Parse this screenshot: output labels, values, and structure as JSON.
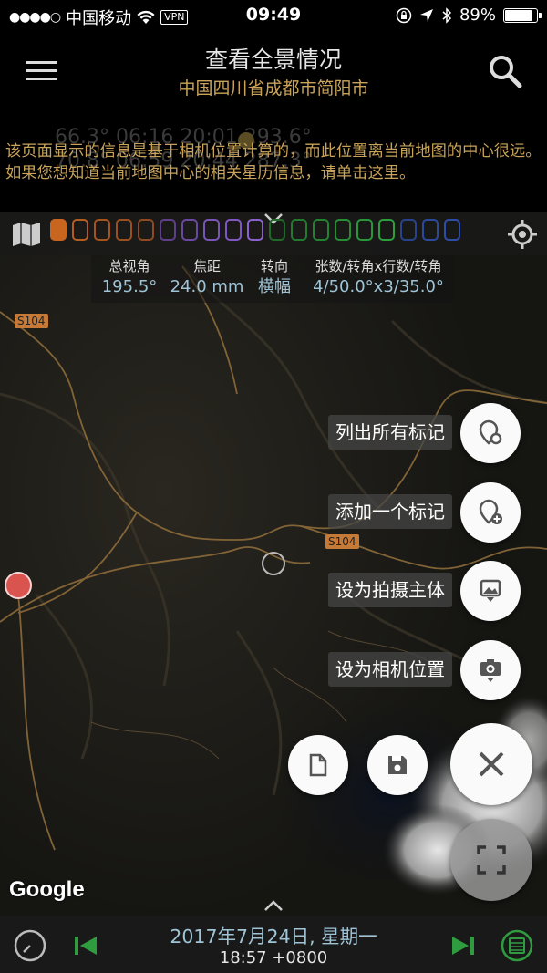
{
  "status_bar": {
    "carrier": "中国移动",
    "vpn": "VPN",
    "time": "09:49",
    "battery": "89%",
    "battery_level": 0.89
  },
  "header": {
    "title": "查看全景情况",
    "subtitle": "中国四川省成都市简阳市"
  },
  "notice": "该页面显示的信息是基于相机位置计算的，而此位置离当前地图的中心很远。如果您想知道当前地图中心的相关星历信息，请单击这里。",
  "ghost_row1": "66.3°  06:16        20:01  293.6°",
  "ghost_row2": "70.8°  06:59        20:44  287.3°",
  "stats": [
    {
      "label": "总视角",
      "value": "195.5°"
    },
    {
      "label": "焦距",
      "value": "24.0 mm"
    },
    {
      "label": "转向",
      "value": "横幅"
    },
    {
      "label": "张数/转角x行数/转角",
      "value": "4/50.0°x3/35.0°"
    }
  ],
  "map": {
    "road_label_1": "S104",
    "road_label_2": "S104",
    "attribution": "Google"
  },
  "fab_menu": [
    {
      "label": "列出所有标记",
      "icon": "marker-list-icon"
    },
    {
      "label": "添加一个标记",
      "icon": "marker-add-icon"
    },
    {
      "label": "设为拍摄主体",
      "icon": "set-subject-icon"
    },
    {
      "label": "设为相机位置",
      "icon": "set-camera-icon"
    }
  ],
  "bottom_bar": {
    "date": "2017年7月24日, 星期一",
    "time": "18:57 +0800"
  },
  "colors": {
    "accent_gold": "#c9a35a",
    "value_blue": "#9fc4d6",
    "green": "#2f9d3f",
    "marker_red": "#d9534f"
  }
}
